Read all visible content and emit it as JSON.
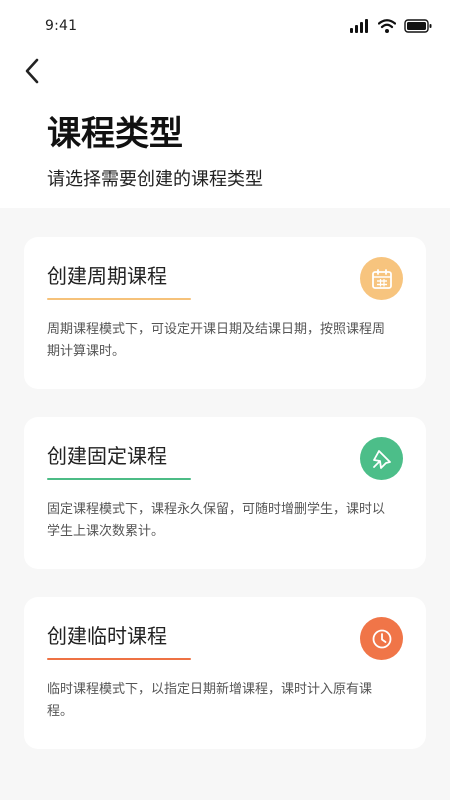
{
  "status_bar": {
    "time": "9:41"
  },
  "header": {
    "title": "课程类型",
    "subtitle": "请选择需要创建的课程类型"
  },
  "cards": [
    {
      "title": "创建周期课程",
      "desc": "周期课程模式下，可设定开课日期及结课日期，按照课程周期计算课时。",
      "icon": "calendar-icon",
      "accent": "#f6c27a",
      "icon_bg": "#f7c47e"
    },
    {
      "title": "创建固定课程",
      "desc": "固定课程模式下，课程永久保留，可随时增删学生，课时以学生上课次数累计。",
      "icon": "pin-icon",
      "accent": "#4cbc86",
      "icon_bg": "#4cbe89"
    },
    {
      "title": "创建临时课程",
      "desc": "临时课程模式下，以指定日期新增课程，课时计入原有课程。",
      "icon": "clock-icon",
      "accent": "#ee7244",
      "icon_bg": "#f07548"
    }
  ]
}
